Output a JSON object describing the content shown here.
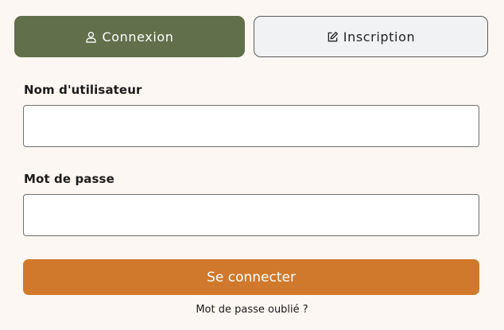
{
  "tabs": {
    "login_label": "Connexion",
    "register_label": "Inscription"
  },
  "form": {
    "username_label": "Nom d'utilisateur",
    "username_value": "",
    "password_label": "Mot de passe",
    "password_value": "",
    "submit_label": "Se connecter",
    "forgot_label": "Mot de passe oublié ?"
  },
  "icons": {
    "login_tab": "user-icon",
    "register_tab": "edit-icon"
  },
  "colors": {
    "active_tab": "#616f4b",
    "inactive_tab": "#f0f2f3",
    "submit_button": "#d0792c",
    "background": "#fdf7f3"
  }
}
